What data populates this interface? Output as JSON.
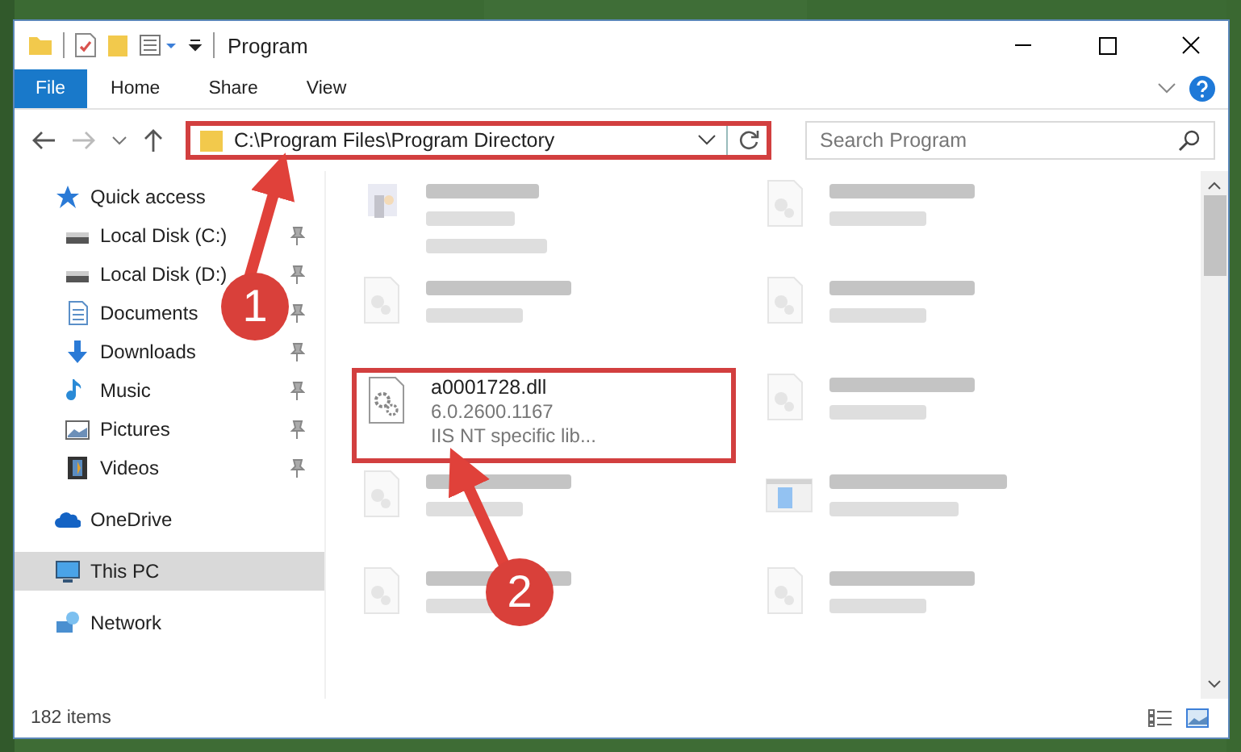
{
  "window": {
    "title": "Program"
  },
  "ribbon_tabs": [
    {
      "label": "File",
      "selected": true
    },
    {
      "label": "Home",
      "selected": false
    },
    {
      "label": "Share",
      "selected": false
    },
    {
      "label": "View",
      "selected": false
    }
  ],
  "address": {
    "path": "C:\\Program Files\\Program Directory",
    "highlighted": true
  },
  "search": {
    "placeholder": "Search Program"
  },
  "sidebar": {
    "items": [
      {
        "label": "Quick access",
        "kind": "star",
        "selected": false,
        "children": [
          {
            "label": "Local Disk (C:)",
            "kind": "disk",
            "pinned": true,
            "selected": false
          },
          {
            "label": "Local Disk (D:)",
            "kind": "disk",
            "pinned": true,
            "selected": false
          },
          {
            "label": "Documents",
            "kind": "doc",
            "pinned": true,
            "selected": false
          },
          {
            "label": "Downloads",
            "kind": "download",
            "pinned": true,
            "selected": false
          },
          {
            "label": "Music",
            "kind": "music",
            "pinned": true,
            "selected": false
          },
          {
            "label": "Pictures",
            "kind": "pictures",
            "pinned": true,
            "selected": false
          },
          {
            "label": "Videos",
            "kind": "videos",
            "pinned": true,
            "selected": false
          }
        ]
      },
      {
        "label": "OneDrive",
        "kind": "cloud",
        "selected": false
      },
      {
        "label": "This PC",
        "kind": "pc",
        "selected": true
      },
      {
        "label": "Network",
        "kind": "network",
        "selected": false
      }
    ]
  },
  "files": [
    {
      "kind": "exe",
      "blurred": true,
      "highlighted": false
    },
    {
      "kind": "dll",
      "blurred": true,
      "highlighted": false
    },
    {
      "kind": "dll",
      "blurred": true,
      "highlighted": false
    },
    {
      "kind": "dll",
      "blurred": true,
      "highlighted": false
    },
    {
      "name": "a0001728.dll",
      "lines": [
        "6.0.2600.1167",
        "IIS NT specific lib..."
      ],
      "kind": "gear",
      "blurred": false,
      "highlighted": true
    },
    {
      "kind": "dll",
      "blurred": true,
      "highlighted": false
    },
    {
      "kind": "dll",
      "blurred": true,
      "highlighted": false
    },
    {
      "kind": "installer",
      "blurred": true,
      "highlighted": false
    },
    {
      "kind": "dll",
      "blurred": true,
      "highlighted": false
    },
    {
      "kind": "dll",
      "blurred": true,
      "highlighted": false
    }
  ],
  "status_bar": {
    "count": "182 items"
  },
  "annotations": [
    {
      "number": "1"
    },
    {
      "number": "2"
    }
  ]
}
